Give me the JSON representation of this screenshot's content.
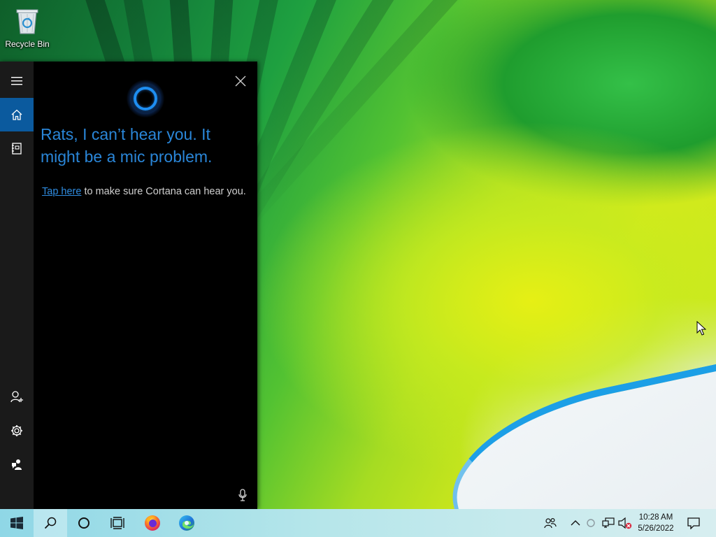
{
  "desktop": {
    "icons": [
      {
        "label": "Recycle Bin",
        "icon": "recycle-bin-icon"
      }
    ]
  },
  "cortana": {
    "rail": {
      "menu_icon": "hamburger-menu-icon",
      "home_icon": "home-icon",
      "notebook_icon": "notebook-icon",
      "account_icon": "add-account-icon",
      "settings_icon": "gear-icon",
      "feedback_icon": "feedback-icon"
    },
    "close_icon": "close-icon",
    "headline": "Rats, I can’t hear you. It might be a mic problem.",
    "hint_link": "Tap here",
    "hint_rest": " to make sure Cortana can hear you.",
    "mic_icon": "microphone-icon",
    "accent_color": "#2a86d8"
  },
  "taskbar": {
    "buttons": [
      "start-button",
      "search-button",
      "cortana-button",
      "task-view-button",
      "firefox-button",
      "edge-button"
    ],
    "tray": [
      "people-icon",
      "show-hidden-icons",
      "loading-icon",
      "network-icon",
      "volume-muted-icon"
    ],
    "time": "10:28 AM",
    "date": "5/26/2022",
    "notification_icon": "action-center-icon"
  }
}
